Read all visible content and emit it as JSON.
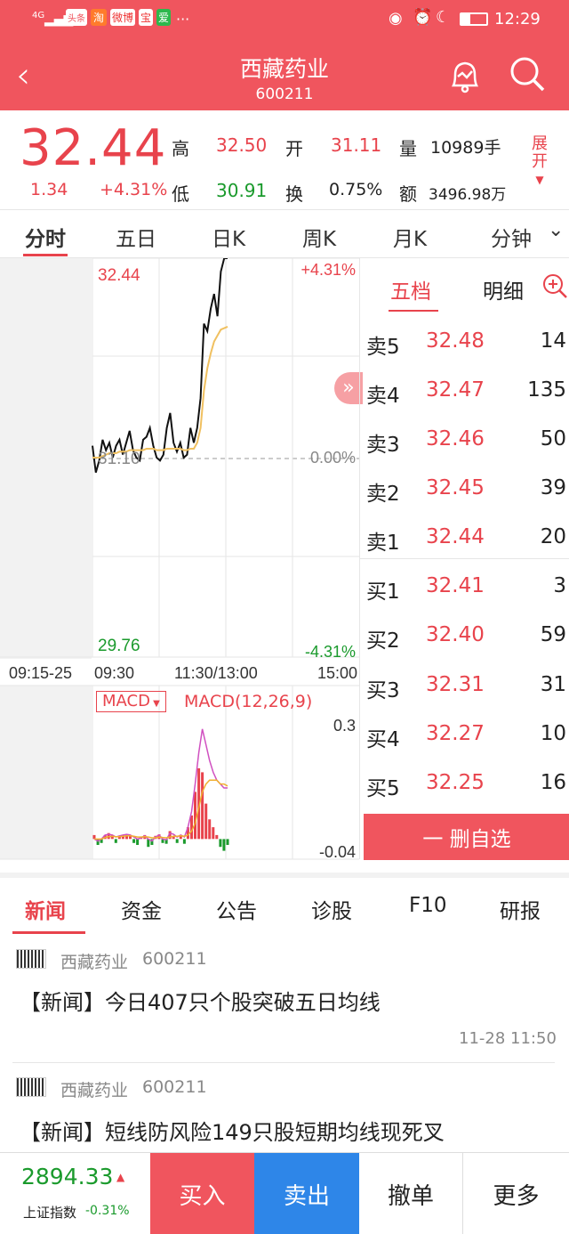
{
  "status": {
    "network": "4G",
    "apps": [
      "头条",
      "淘",
      "微博",
      "宝",
      "爱"
    ],
    "more": "···",
    "time": "12:29"
  },
  "header": {
    "title": "西藏药业",
    "code": "600211"
  },
  "quote": {
    "price": "32.44",
    "change": "1.34",
    "change_pct": "+4.31%",
    "high_label": "高",
    "high": "32.50",
    "open_label": "开",
    "open": "31.11",
    "vol_label": "量",
    "vol": "10989手",
    "low_label": "低",
    "low": "30.91",
    "turnover_label": "换",
    "turnover": "0.75%",
    "amount_label": "额",
    "amount": "3496.98万",
    "expand": "展开"
  },
  "tabs": [
    "分时",
    "五日",
    "日K",
    "周K",
    "月K",
    "分钟"
  ],
  "chart": {
    "top_price": "32.44",
    "top_pct": "+4.31%",
    "mid_price": "31.10",
    "mid_pct": "0.00%",
    "bottom_price": "29.76",
    "bottom_pct": "-4.31%",
    "times": [
      "09:15-25",
      "09:30",
      "11:30/13:00",
      "15:00"
    ],
    "macd_button": "MACD",
    "macd_label": "MACD(12,26,9)",
    "macd_top": "0.3",
    "macd_bottom": "-0.04"
  },
  "chart_data": {
    "type": "line",
    "series": [
      {
        "values": [
          31.18,
          31.0,
          31.08,
          31.22,
          31.15,
          31.2,
          31.1,
          31.18,
          31.22,
          31.12,
          31.2,
          31.28,
          31.15,
          31.1,
          31.08,
          31.22,
          31.24,
          31.3,
          31.18,
          31.1,
          31.08,
          31.12,
          31.3,
          31.4,
          31.2,
          31.14,
          31.2,
          31.1,
          31.12,
          31.3,
          31.2,
          31.3,
          31.5,
          32.0,
          31.95,
          32.1,
          32.2,
          32.05,
          32.35,
          32.44,
          32.44
        ]
      },
      {
        "values": [
          31.1,
          31.1,
          31.1,
          31.11,
          31.12,
          31.13,
          31.13,
          31.13,
          31.14,
          31.14,
          31.14,
          31.15,
          31.15,
          31.15,
          31.15,
          31.15,
          31.16,
          31.16,
          31.16,
          31.15,
          31.15,
          31.15,
          31.16,
          31.16,
          31.16,
          31.16,
          31.16,
          31.15,
          31.15,
          31.16,
          31.16,
          31.2,
          31.3,
          31.55,
          31.7,
          31.8,
          31.88,
          31.92,
          31.96,
          31.97,
          31.98
        ]
      }
    ],
    "ylim": [
      29.76,
      32.44
    ]
  },
  "macd_data": {
    "ylim": [
      -0.04,
      0.3
    ],
    "hist": [
      0.01,
      -0.015,
      -0.01,
      0.01,
      0.015,
      0.01,
      -0.01,
      0.005,
      0.01,
      0.012,
      0.008,
      -0.01,
      -0.015,
      0.005,
      0.01,
      -0.02,
      -0.015,
      0.008,
      0.012,
      -0.01,
      -0.012,
      0.02,
      0.005,
      -0.01,
      0.01,
      -0.012,
      0.03,
      0.06,
      0.12,
      0.18,
      0.17,
      0.09,
      0.05,
      0.03,
      0.01,
      -0.02,
      -0.03,
      -0.015
    ],
    "dif": [
      0.0,
      -0.005,
      0.0,
      0.01,
      0.012,
      0.01,
      0.005,
      0.008,
      0.01,
      0.012,
      0.01,
      0.005,
      0.0,
      0.003,
      0.008,
      0.0,
      -0.005,
      0.005,
      0.01,
      0.0,
      -0.002,
      0.015,
      0.012,
      0.005,
      0.01,
      0.005,
      0.03,
      0.07,
      0.14,
      0.22,
      0.28,
      0.24,
      0.2,
      0.17,
      0.15,
      0.14,
      0.13,
      0.13
    ],
    "dea": [
      0.0,
      0.0,
      0.0,
      0.004,
      0.006,
      0.007,
      0.006,
      0.006,
      0.007,
      0.008,
      0.008,
      0.007,
      0.005,
      0.005,
      0.006,
      0.005,
      0.003,
      0.003,
      0.005,
      0.004,
      0.003,
      0.005,
      0.007,
      0.007,
      0.008,
      0.007,
      0.01,
      0.02,
      0.04,
      0.08,
      0.12,
      0.14,
      0.15,
      0.15,
      0.15,
      0.14,
      0.14,
      0.135
    ]
  },
  "orderbook": {
    "tab_active": "五档",
    "tab_detail": "明细",
    "asks": [
      {
        "label": "卖5",
        "price": "32.48",
        "vol": "14"
      },
      {
        "label": "卖4",
        "price": "32.47",
        "vol": "135"
      },
      {
        "label": "卖3",
        "price": "32.46",
        "vol": "50"
      },
      {
        "label": "卖2",
        "price": "32.45",
        "vol": "39"
      },
      {
        "label": "卖1",
        "price": "32.44",
        "vol": "20"
      }
    ],
    "bids": [
      {
        "label": "买1",
        "price": "32.41",
        "vol": "3"
      },
      {
        "label": "买2",
        "price": "32.40",
        "vol": "59"
      },
      {
        "label": "买3",
        "price": "32.31",
        "vol": "31"
      },
      {
        "label": "买4",
        "price": "32.27",
        "vol": "10"
      },
      {
        "label": "买5",
        "price": "32.25",
        "vol": "16"
      }
    ],
    "remove_watch": "一 删自选"
  },
  "news_tabs": [
    "新闻",
    "资金",
    "公告",
    "诊股",
    "F10",
    "研报"
  ],
  "news": [
    {
      "stock": "西藏药业",
      "code": "600211",
      "title": "【新闻】今日407只个股突破五日均线",
      "time": "11-28 11:50"
    },
    {
      "stock": "西藏药业",
      "code": "600211",
      "title": "【新闻】短线防风险149只股短期均线现死叉"
    }
  ],
  "bottom": {
    "index_value": "2894.33",
    "index_name": "上证指数",
    "index_pct": "-0.31%",
    "buy": "买入",
    "sell": "卖出",
    "cancel": "撤单",
    "more": "更多"
  },
  "colors": {
    "brand": "#f0555e",
    "up": "#e8434c",
    "down": "#1a9a2c",
    "sell_btn": "#2e86e8"
  }
}
